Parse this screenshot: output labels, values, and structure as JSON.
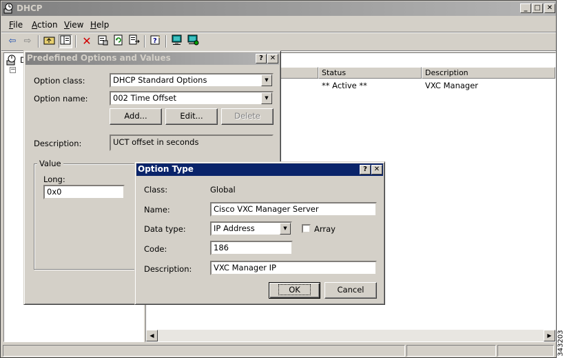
{
  "window": {
    "title": "DHCP",
    "minimize_glyph": "_",
    "maximize_glyph": "□",
    "close_glyph": "✕"
  },
  "menu": [
    "File",
    "Action",
    "View",
    "Help"
  ],
  "toolbar_icons": [
    "back-arrow-icon",
    "forward-arrow-icon",
    "up-folder-icon",
    "show-hide-tree-icon",
    "delete-icon",
    "properties-icon",
    "refresh-icon",
    "export-list-icon",
    "help-icon",
    "server-icon",
    "server-network-icon"
  ],
  "tree": {
    "root_label": "D"
  },
  "list": {
    "columns": [
      "Status",
      "Description"
    ],
    "rows": [
      {
        "status": "** Active **",
        "description": "VXC Manager"
      }
    ]
  },
  "predefined_dialog": {
    "title": "Predefined Options and Values",
    "help_glyph": "?",
    "close_glyph": "✕",
    "option_class_label": "Option class:",
    "option_class_value": "DHCP Standard Options",
    "option_name_label": "Option name:",
    "option_name_value": "002 Time Offset",
    "add_button": "Add...",
    "edit_button": "Edit...",
    "delete_button": "Delete",
    "description_label": "Description:",
    "description_value": "UCT offset in seconds",
    "value_group_label": "Value",
    "long_label": "Long:",
    "long_value": "0x0"
  },
  "option_type_dialog": {
    "title": "Option Type",
    "help_glyph": "?",
    "close_glyph": "✕",
    "class_label": "Class:",
    "class_value": "Global",
    "name_label": "Name:",
    "name_value": "Cisco VXC Manager Server",
    "data_type_label": "Data type:",
    "data_type_value": "IP Address",
    "array_label": "Array",
    "array_checked": false,
    "code_label": "Code:",
    "code_value": "186",
    "description_label": "Description:",
    "description_value": "VXC Manager IP",
    "ok_button": "OK",
    "cancel_button": "Cancel"
  },
  "side_caption": "343203",
  "colors": {
    "active_title": "#0a246a",
    "inactive_title": "#808080",
    "face": "#d4d0c8"
  }
}
